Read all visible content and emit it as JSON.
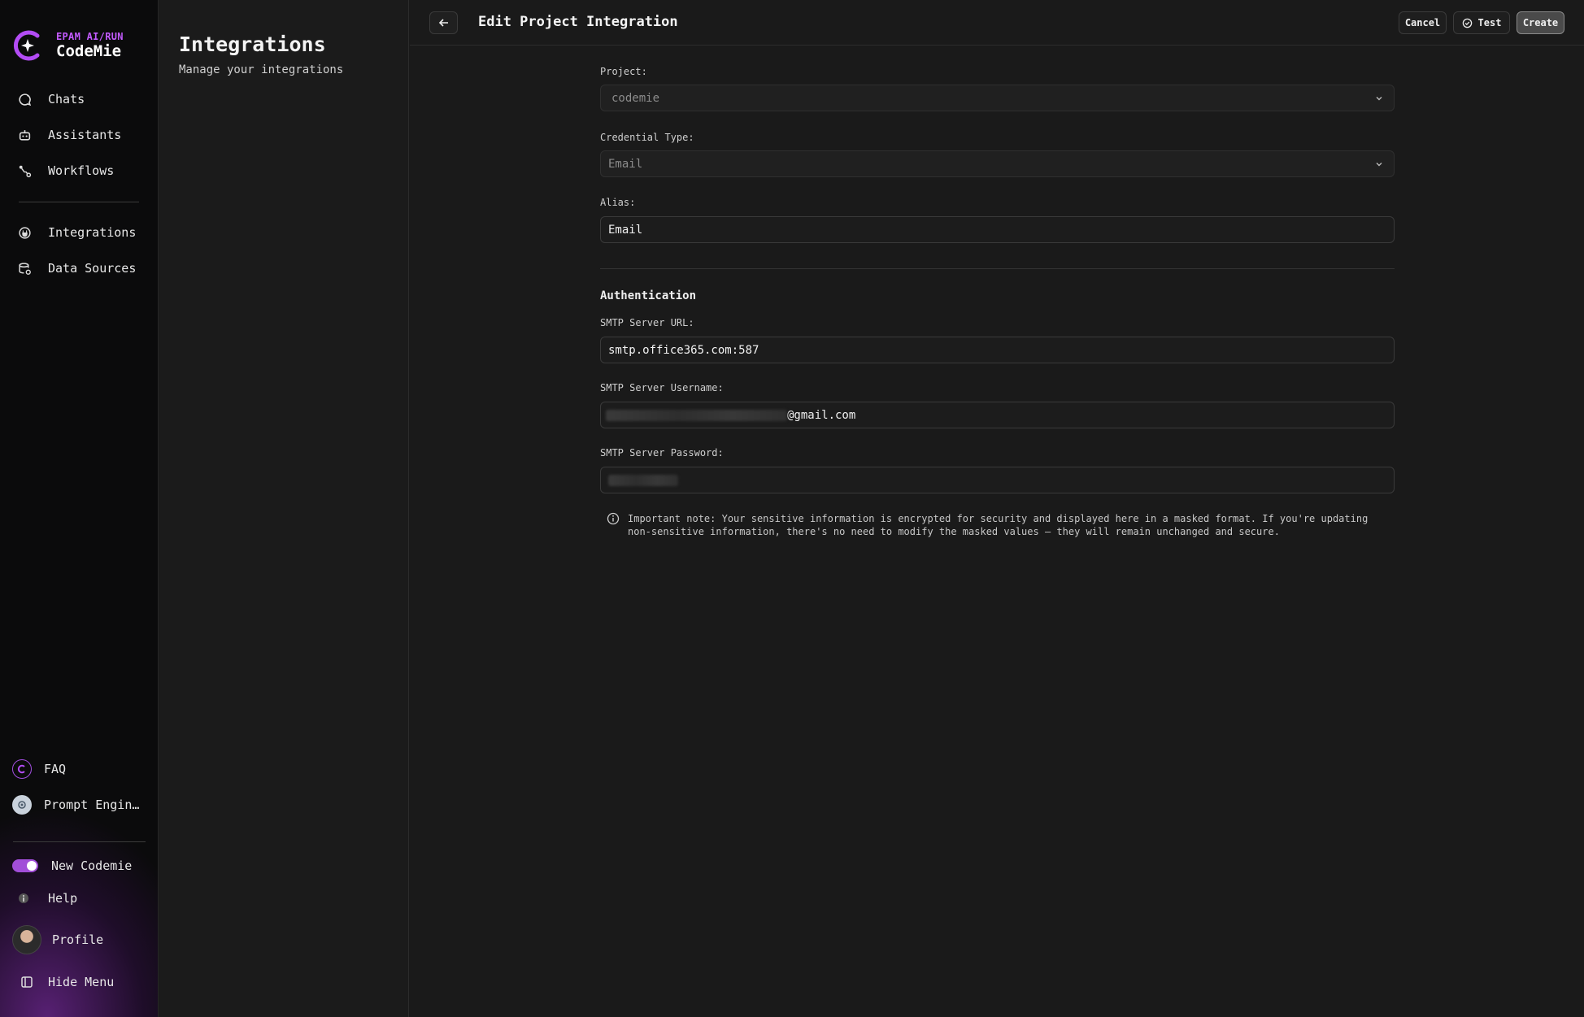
{
  "brand": {
    "sub": "EPAM AI/RUN",
    "name": "CodeMie"
  },
  "nav": {
    "items": [
      {
        "label": "Chats",
        "icon": "chat-icon"
      },
      {
        "label": "Assistants",
        "icon": "robot-icon"
      },
      {
        "label": "Workflows",
        "icon": "workflow-icon"
      },
      {
        "label": "Integrations",
        "icon": "plug-icon"
      },
      {
        "label": "Data Sources",
        "icon": "database-icon"
      }
    ],
    "bottom": {
      "faq": "FAQ",
      "prompt": "Prompt Engin…",
      "new_codemie": "New Codemie",
      "new_codemie_on": true,
      "help": "Help",
      "profile": "Profile",
      "hide_menu": "Hide Menu"
    }
  },
  "subpanel": {
    "title": "Integrations",
    "subtitle": "Manage your integrations"
  },
  "header": {
    "title": "Edit Project Integration",
    "cancel": "Cancel",
    "test": "Test",
    "create": "Create"
  },
  "form": {
    "project": {
      "label": "Project:",
      "value": "codemie"
    },
    "credential_type": {
      "label": "Credential Type:",
      "value": "Email"
    },
    "alias": {
      "label": "Alias:",
      "value": "Email"
    },
    "auth_heading": "Authentication",
    "smtp_url": {
      "label": "SMTP Server URL:",
      "value": "smtp.office365.com:587"
    },
    "smtp_username": {
      "label": "SMTP Server Username:",
      "value_suffix": "@gmail.com"
    },
    "smtp_password": {
      "label": "SMTP Server Password:"
    },
    "note": "Important note: Your sensitive information is encrypted for security and displayed here in a masked format. If you're updating non-sensitive information, there's no need to modify the masked values — they will remain unchanged and secure."
  },
  "colors": {
    "accent": "#a14ed8",
    "brand": "#c35bff",
    "background": "#1a1a1a"
  }
}
